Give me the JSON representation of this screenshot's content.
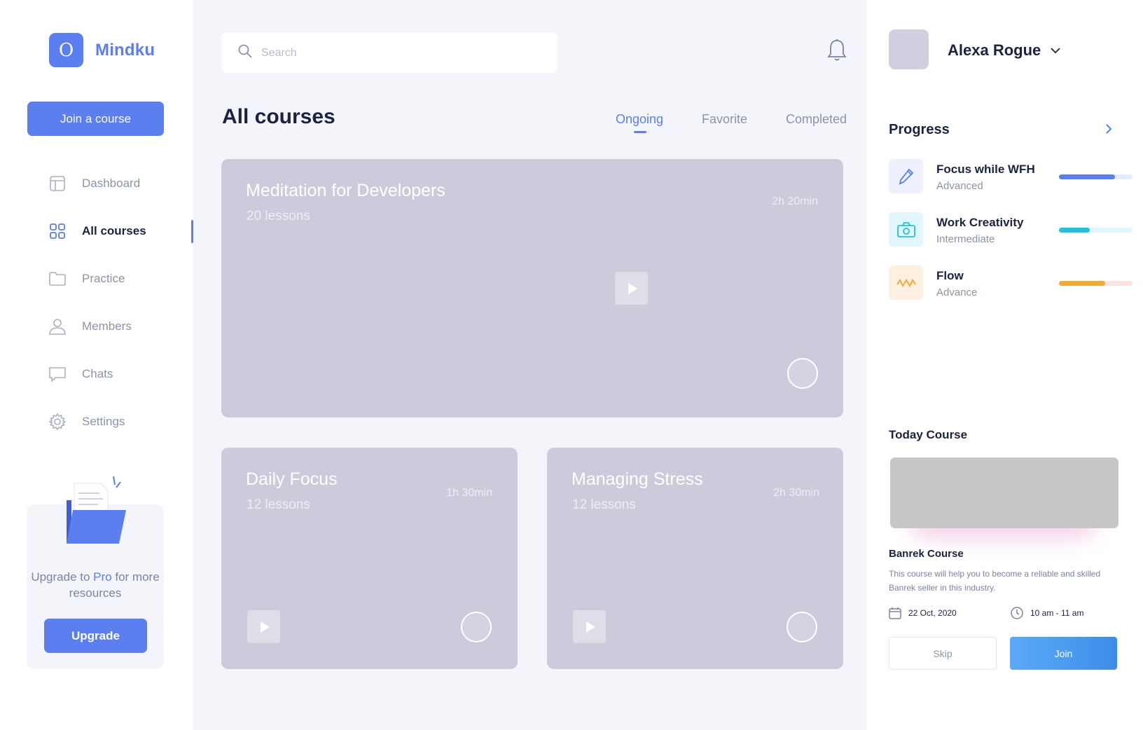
{
  "app": {
    "logo_letter": "O",
    "name": "Mindku"
  },
  "sidebar": {
    "join_label": "Join a course",
    "items": [
      {
        "label": "Dashboard",
        "icon": "dashboard-icon"
      },
      {
        "label": "All courses",
        "icon": "grid-icon",
        "active": true
      },
      {
        "label": "Practice",
        "icon": "folder-icon"
      },
      {
        "label": "Members",
        "icon": "user-icon"
      },
      {
        "label": "Chats",
        "icon": "chat-icon"
      },
      {
        "label": "Settings",
        "icon": "gear-icon"
      }
    ],
    "upgrade": {
      "text_before": "Upgrade to ",
      "text_pro": "Pro",
      "text_after": " for more resources",
      "button_label": "Upgrade"
    }
  },
  "header": {
    "search_placeholder": "Search",
    "notification_icon": "bell-icon"
  },
  "main": {
    "title": "All courses",
    "tabs": [
      {
        "label": "Ongoing",
        "active": true
      },
      {
        "label": "Favorite"
      },
      {
        "label": "Completed"
      }
    ],
    "courses": [
      {
        "title": "Meditation for Developers",
        "lessons": "20 lessons",
        "duration": "2h 20min"
      },
      {
        "title": "Daily Focus",
        "lessons": "12 lessons",
        "duration": "1h 30min"
      },
      {
        "title": "Managing Stress",
        "lessons": "12 lessons",
        "duration": "2h 30min"
      }
    ]
  },
  "user": {
    "name": "Alexa Rogue"
  },
  "progress": {
    "title": "Progress",
    "items": [
      {
        "name": "Focus while WFH",
        "level": "Advanced",
        "percent": 76,
        "color": "#5b7ef0",
        "track": "#e5eafc",
        "icon_bg": "#eef1fd",
        "icon": "pencil-icon"
      },
      {
        "name": "Work Creativity",
        "level": "Intermediate",
        "percent": 42,
        "color": "#1ec3e0",
        "track": "#dff6fa",
        "icon_bg": "#e1f7fb",
        "icon": "camera-icon"
      },
      {
        "name": "Flow",
        "level": "Advance",
        "percent": 63,
        "color": "#f7a935",
        "track": "#fde4e4",
        "icon_bg": "#fdf0e1",
        "icon": "wave-icon"
      }
    ]
  },
  "today": {
    "title": "Today Course",
    "course_name": "Banrek Course",
    "description": "This course will help you to become a reliable and skilled Banrek seller in this industry.",
    "date": "22 Oct, 2020",
    "time": "10 am - 11 am",
    "skip_label": "Skip",
    "join_label": "Join"
  },
  "colors": {
    "accent": "#5b7ef0",
    "card": "#cccbdc",
    "main_bg": "#f4f5fb"
  }
}
